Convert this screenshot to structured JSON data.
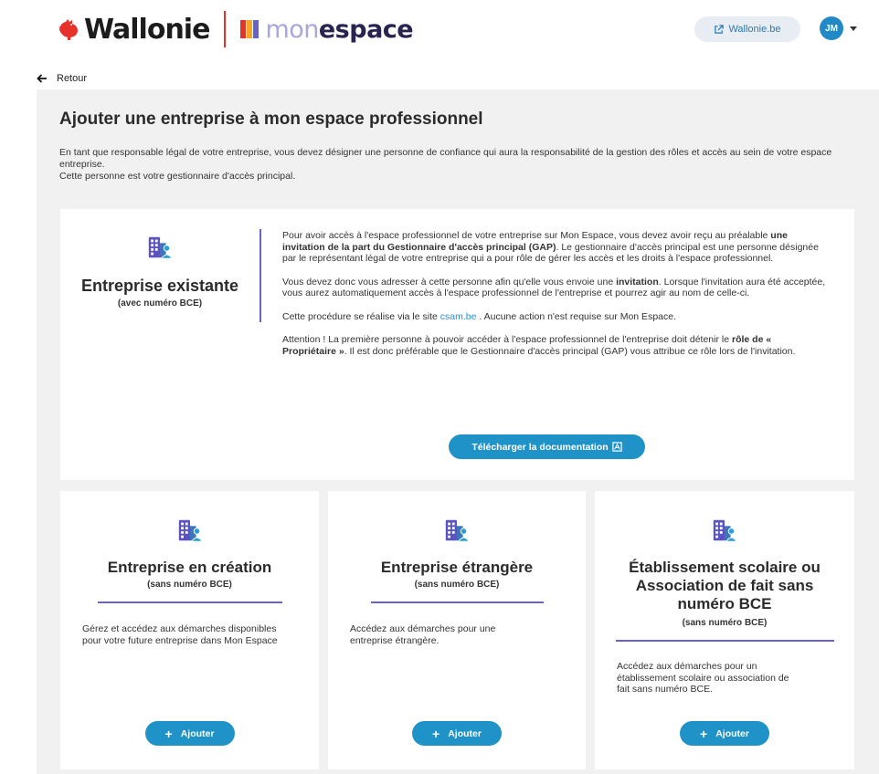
{
  "header": {
    "brand_wallonie": "Wallonie",
    "brand_mon": "mon",
    "brand_espace": "espace",
    "wallonie_link": "Wallonie.be",
    "avatar_initials": "JM"
  },
  "nav": {
    "back_label": "Retour"
  },
  "page": {
    "title": "Ajouter une entreprise à mon espace professionnel",
    "intro_line1": "En tant que responsable légal de votre entreprise, vous devez désigner une personne de confiance qui aura la responsabilité de la gestion des rôles et accès au sein de votre espace entreprise.",
    "intro_line2": "Cette personne est votre gestionnaire d'accès principal."
  },
  "existing": {
    "title": "Entreprise existante",
    "subtitle": "(avec numéro BCE)",
    "p1_a": "Pour avoir accès à l'espace professionnel de votre entreprise sur Mon Espace, vous devez avoir reçu au préalable ",
    "p1_b": "une invitation de la part du Gestionnaire d'accès principal (GAP)",
    "p1_c": ". Le gestionnaire d'accès principal est une personne désignée par le représentant légal de votre entreprise qui a pour rôle de gérer les accès et les droits à l'espace professionnel.",
    "p2_a": "Vous devez donc vous adresser à cette personne afin qu'elle vous envoie une ",
    "p2_b": "invitation",
    "p2_c": ". Lorsque l'invitation aura été acceptée, vous aurez automatiquement accès à l'espace professionnel de l'entreprise et pourrez agir au nom de celle-ci.",
    "p3_a": "Cette procédure se réalise via le site ",
    "p3_link": "csam.be",
    "p3_c": " . Aucune action n'est requise sur Mon Espace.",
    "p4_a": "Attention ! La première personne à pouvoir accéder à l'espace professionnel de l'entreprise doit détenir le ",
    "p4_b": "rôle de « Propriétaire »",
    "p4_c": ". Il est donc préférable que le Gestionnaire d'accès principal (GAP) vous attribue ce rôle lors de l'invitation.",
    "download_label": "Télécharger la documentation"
  },
  "cards": [
    {
      "title": "Entreprise en création",
      "subtitle": "(sans numéro BCE)",
      "description": "Gérez et accédez aux démarches disponibles pour votre future entreprise dans Mon Espace",
      "button": "Ajouter"
    },
    {
      "title": "Entreprise étrangère",
      "subtitle": "(sans numéro BCE)",
      "description": "Accédez aux démarches pour une entreprise étrangère.",
      "button": "Ajouter"
    },
    {
      "title": "Établissement scolaire ou Association de fait sans numéro BCE",
      "subtitle": "(sans numéro BCE)",
      "description": "Accédez aux démarches pour un établissement scolaire ou association de fait sans numéro BCE.",
      "button": "Ajouter"
    }
  ],
  "colors": {
    "accent": "#1f93c7",
    "divider": "#6863c8",
    "icon": "#5b53c2",
    "background": "#f1f1f1"
  }
}
